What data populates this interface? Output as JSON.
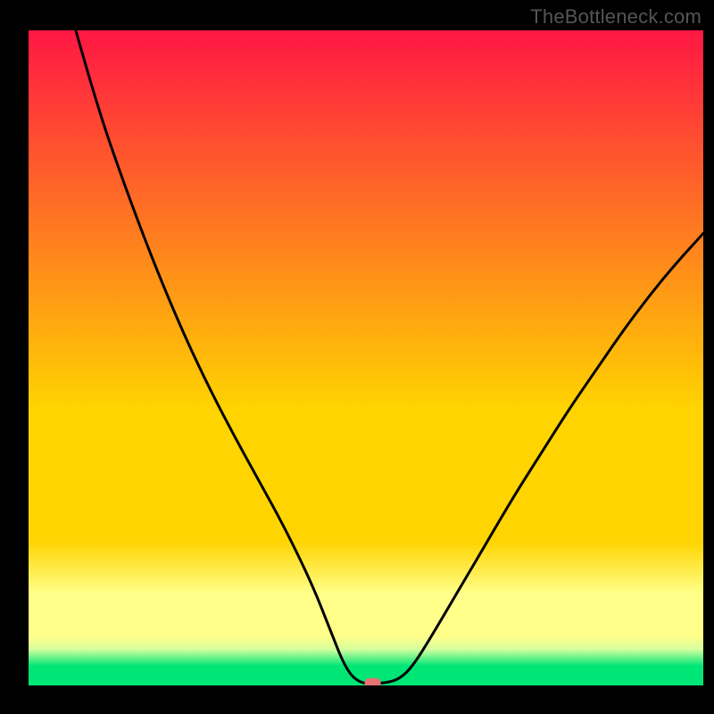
{
  "watermark": "TheBottleneck.com",
  "colors": {
    "frame": "#000000",
    "grad_top": "#ff1744",
    "grad_mid": "#ffd400",
    "grad_band_light": "#ffff8a",
    "grad_bottom": "#00e676",
    "curve": "#000000",
    "marker": "#e57373"
  },
  "chart_data": {
    "type": "line",
    "title": "",
    "xlabel": "",
    "ylabel": "",
    "xrange": [
      0,
      100
    ],
    "ylim": [
      0,
      100
    ],
    "annotations": [],
    "series": [
      {
        "name": "bottleneck-curve",
        "x": [
          7,
          10,
          14,
          18,
          22,
          26,
          30,
          34,
          38,
          42,
          44.5,
          47,
          49,
          51,
          53,
          55,
          57,
          60,
          64,
          68,
          72,
          76,
          80,
          84,
          88,
          92,
          96,
          100
        ],
        "y": [
          100,
          89,
          77,
          66,
          56,
          47,
          39,
          31.5,
          24,
          15.5,
          9,
          2.5,
          0.4,
          0.3,
          0.4,
          1,
          3,
          8,
          15,
          22,
          29,
          35.5,
          42,
          48,
          54,
          59.5,
          64.5,
          69
        ]
      }
    ],
    "marker": {
      "x": 51,
      "y": 0.3
    },
    "gradient_stops_pct": [
      0,
      58,
      78,
      86,
      92.5,
      94.5,
      97,
      100
    ]
  }
}
